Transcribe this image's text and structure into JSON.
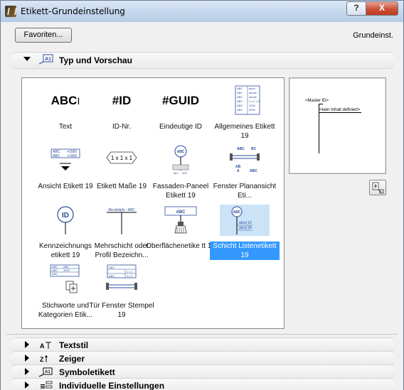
{
  "window": {
    "title": "Etikett-Grundeinstellung",
    "help_label": "?",
    "close_label": "X"
  },
  "top": {
    "favoriten_label": "Favoriten...",
    "status": "Grundeinst."
  },
  "sections": [
    {
      "label": "Typ und Vorschau",
      "icon": "A1",
      "expanded": true
    },
    {
      "label": "Textstil",
      "icon": "A"
    },
    {
      "label": "Zeiger",
      "icon": "Z"
    },
    {
      "label": "Symboletikett",
      "icon": "A1"
    },
    {
      "label": "Individuelle Einstellungen",
      "icon": "≡"
    }
  ],
  "items": [
    {
      "label": "Text",
      "icon_text": "ABC"
    },
    {
      "label": "ID-Nr.",
      "icon_text": "#ID"
    },
    {
      "label": "Eindeutige ID",
      "icon_text": "#GUID"
    },
    {
      "label": "Allgemeines Etikett 19",
      "icon_text": ""
    },
    {
      "label": "Ansicht Etikett 19",
      "icon_text": ""
    },
    {
      "label": "Etikett Maße 19",
      "icon_text": "1 x 1 x 1"
    },
    {
      "label": "Fassaden-Paneel Etikett 19",
      "icon_text": "ABC"
    },
    {
      "label": "Fenster Planansicht Eti...",
      "icon_text": ""
    },
    {
      "label": "Kennzeichnungs etikett 19",
      "icon_text": "ID"
    },
    {
      "label": "Mehrschicht oder Profil Bezeichn...",
      "icon_text": "Abcdefghij - ABC"
    },
    {
      "label": "Oberflächenetike tt 19",
      "icon_text": "ABC"
    },
    {
      "label": "Schicht Listenetikett 19",
      "icon_text": "ABC",
      "selected": true
    },
    {
      "label": "Stichworte und Kategorien Etik...",
      "icon_text": ""
    },
    {
      "label": "Tür Fenster Stempel 19",
      "icon_text": ""
    }
  ],
  "icon_details": {
    "allgemein": [
      "ABC",
      "ABC",
      "ABC",
      "ABC",
      "ABC",
      "ABC",
      "abcd",
      "abcde",
      "abcde",
      "1 x 1 x 1",
      "1000",
      "2000"
    ],
    "ansicht": [
      "ABC",
      "+2000",
      "ABC",
      "+1000"
    ],
    "fassade": [
      "abc",
      "900"
    ],
    "fenster": [
      "ABC",
      "BC",
      "AB",
      "A",
      "ABC"
    ],
    "schicht": [
      "abcd 12",
      "abcd 34"
    ],
    "stichworte": [
      "ABC",
      "ABC",
      "ABC",
      "1000",
      "ABC"
    ],
    "tuer": [
      "ABC",
      "1 x 1",
      "1 x 1",
      "ABC"
    ]
  },
  "preview": {
    "master": "<Master ID>",
    "inhalt": "<kein Inhalt definiert>"
  }
}
